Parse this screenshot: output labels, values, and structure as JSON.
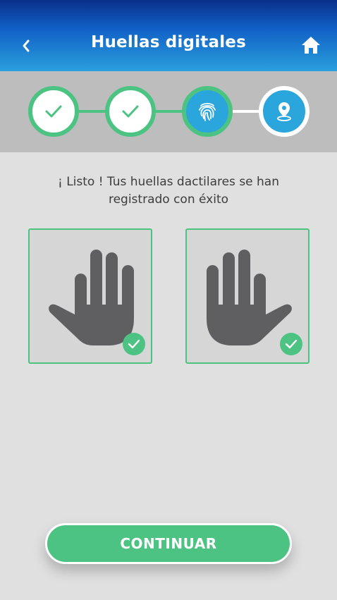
{
  "header": {
    "title": "Huellas digitales",
    "back_icon": "chevron-left-icon",
    "home_icon": "home-icon"
  },
  "stepper": {
    "steps": [
      {
        "status": "done",
        "icon": "check-icon"
      },
      {
        "status": "done",
        "icon": "check-icon"
      },
      {
        "status": "active",
        "icon": "fingerprint-icon"
      },
      {
        "status": "pending",
        "icon": "location-pin-icon"
      }
    ]
  },
  "main": {
    "message_line1": "¡ Listo ! Tus huellas dactilares se han",
    "message_line2": "registrado con éxito",
    "hands": [
      {
        "side": "left",
        "status": "registered",
        "icon": "left-hand-icon"
      },
      {
        "side": "right",
        "status": "registered",
        "icon": "right-hand-icon"
      }
    ]
  },
  "footer": {
    "continue_label": "CONTINUAR"
  },
  "colors": {
    "header_top": "#0a2f8a",
    "header_bottom": "#2a9fdc",
    "accent_green": "#4cc383",
    "accent_blue": "#2aa6dc",
    "hand_gray": "#5f5f61",
    "background": "#e0e0e0",
    "stepper_bg": "#bdbdbd"
  }
}
